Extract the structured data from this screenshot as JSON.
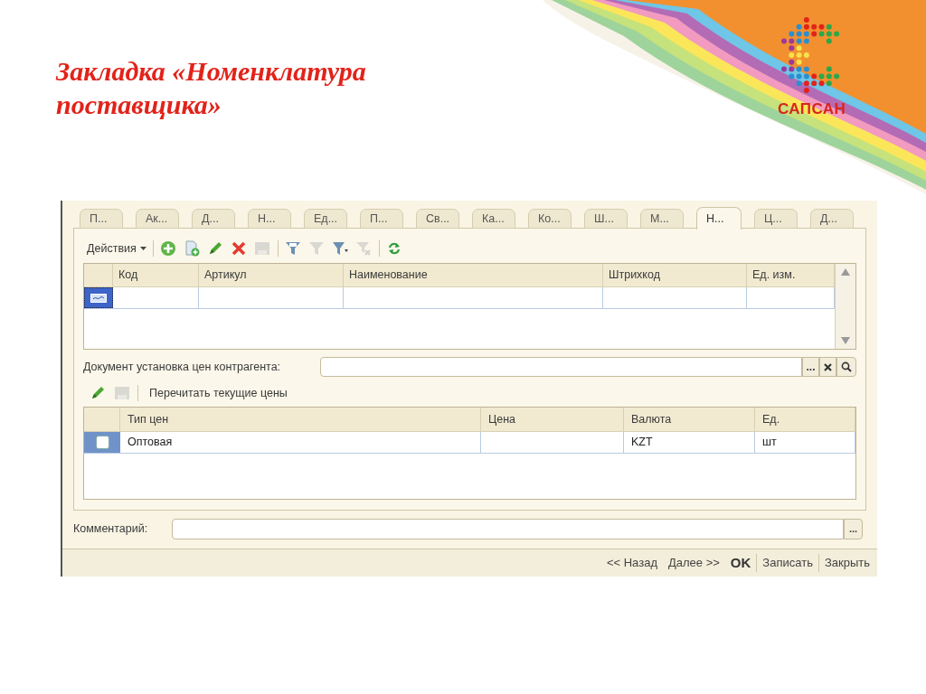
{
  "slide": {
    "title": "Закладка «Номенклатура поставщика»",
    "logo_text": "САПСАН"
  },
  "tabs": [
    {
      "label": "П...",
      "selected": false
    },
    {
      "label": "Ак...",
      "selected": false
    },
    {
      "label": "Д...",
      "selected": false
    },
    {
      "label": "Н...",
      "selected": false
    },
    {
      "label": "Ед...",
      "selected": false
    },
    {
      "label": "П...",
      "selected": false
    },
    {
      "label": "Св...",
      "selected": false
    },
    {
      "label": "Ка...",
      "selected": false
    },
    {
      "label": "Ко...",
      "selected": false
    },
    {
      "label": "Ш...",
      "selected": false
    },
    {
      "label": "М...",
      "selected": false
    },
    {
      "label": "Н...",
      "selected": true
    },
    {
      "label": "Ц...",
      "selected": false
    },
    {
      "label": "Д...",
      "selected": false
    }
  ],
  "toolbar": {
    "actions_label": "Действия",
    "tools": [
      {
        "kind": "add",
        "disabled": false
      },
      {
        "kind": "copy",
        "disabled": false
      },
      {
        "kind": "edit",
        "disabled": false
      },
      {
        "kind": "delete",
        "disabled": false
      },
      {
        "kind": "save",
        "disabled": true
      },
      {
        "kind": "sep"
      },
      {
        "kind": "filter",
        "disabled": false
      },
      {
        "kind": "filter",
        "disabled": true
      },
      {
        "kind": "filter-menu",
        "disabled": false
      },
      {
        "kind": "filter-clear",
        "disabled": true
      },
      {
        "kind": "sep"
      },
      {
        "kind": "refresh",
        "disabled": false
      }
    ]
  },
  "items_table": {
    "columns": [
      "Код",
      "Артикул",
      "Наименование",
      "Штрихкод",
      "Ед. изм."
    ],
    "rows": [
      {
        "selected": true,
        "cells": [
          "",
          "",
          "",
          "",
          ""
        ]
      }
    ]
  },
  "document_field": {
    "label": "Документ установка цен контрагента:",
    "choose_button": "..."
  },
  "prices_toolbar": {
    "tools": [
      {
        "kind": "edit",
        "disabled": false
      },
      {
        "kind": "save",
        "disabled": true
      },
      {
        "kind": "sep"
      }
    ],
    "reread_button": "Перечитать текущие цены"
  },
  "prices_table": {
    "columns": [
      "Тип цен",
      "Цена",
      "Валюта",
      "Ед."
    ],
    "rows": [
      {
        "checked": false,
        "cells": [
          "Оптовая",
          "",
          "KZT",
          "шт"
        ]
      }
    ]
  },
  "comment_field": {
    "label": "Комментарий:",
    "choose_button": "..."
  },
  "footer_buttons": [
    {
      "label": "<< Назад",
      "default": false
    },
    {
      "label": "Далее >>",
      "default": false
    },
    {
      "label": "OK",
      "default": true
    },
    {
      "label": "Записать",
      "default": false
    },
    {
      "label": "Закрыть",
      "default": false
    }
  ]
}
